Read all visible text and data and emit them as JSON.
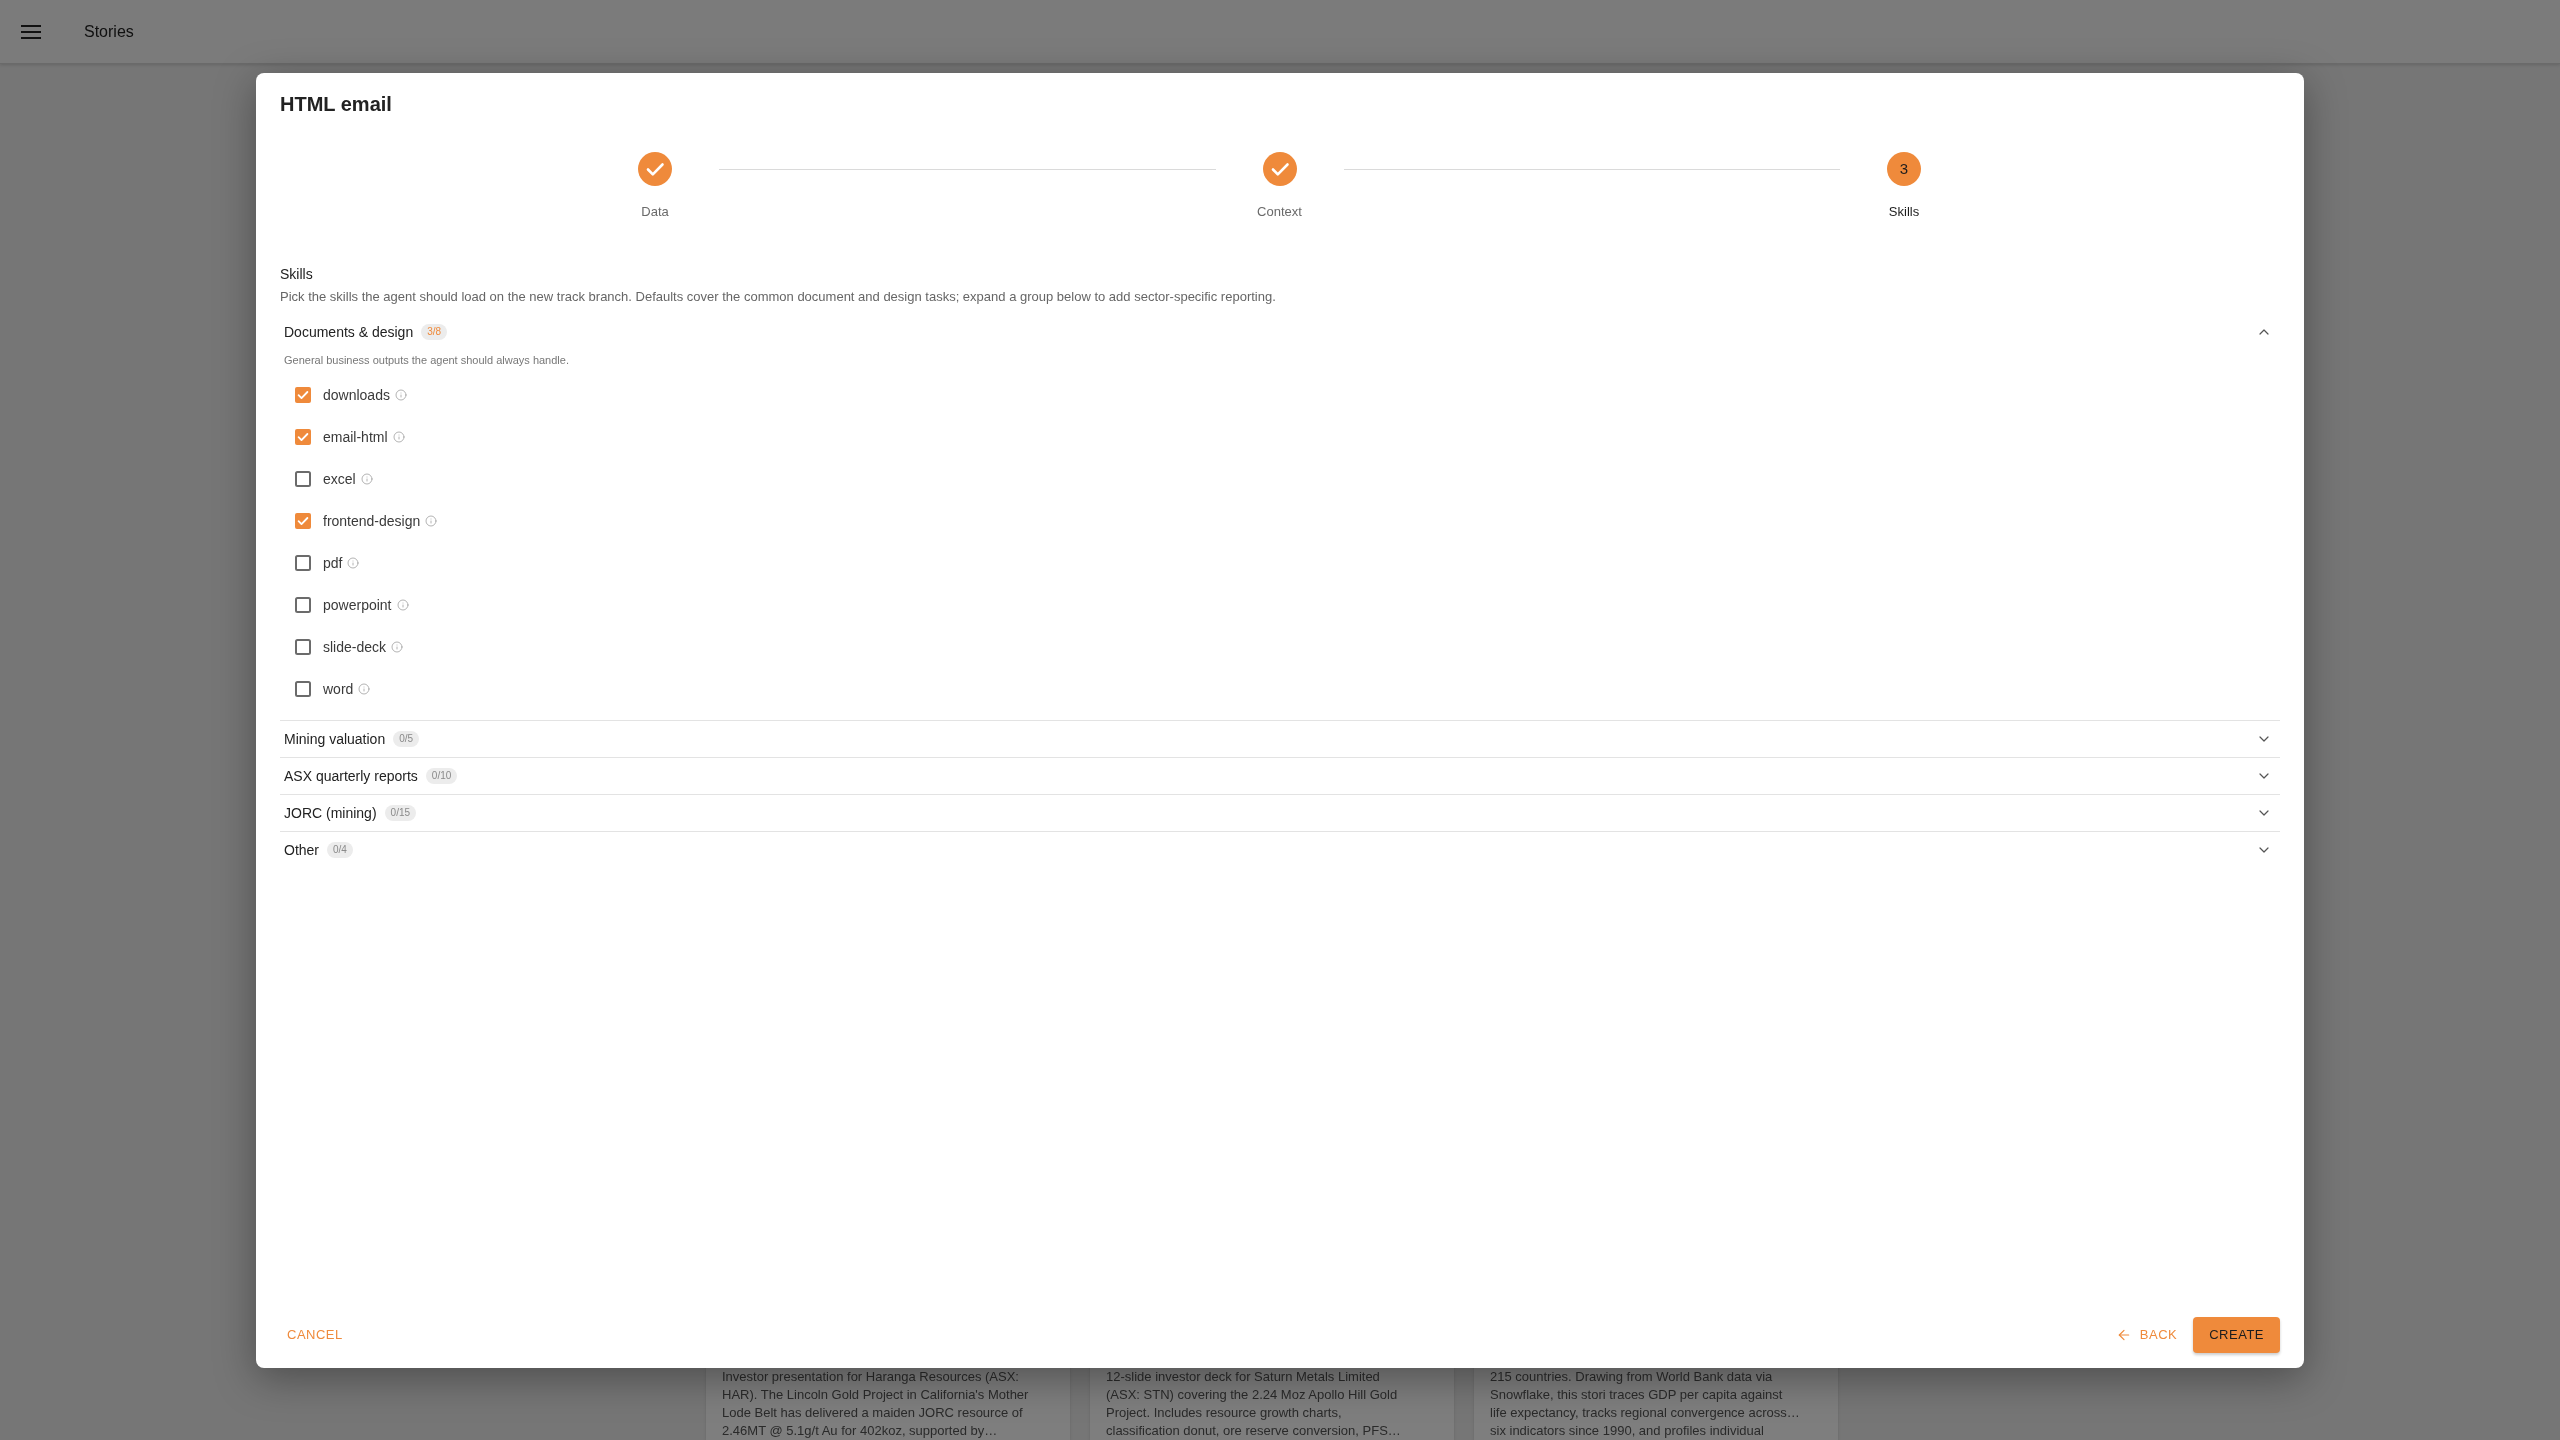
{
  "app_bar": {
    "title": "Stories"
  },
  "background_cards": [
    {
      "lines": [
        "Investor presentation for Haranga Resources (ASX:",
        "HAR). The Lincoln Gold Project in California's Mother",
        "Lode Belt has delivered a maiden JORC resource of",
        "2.46MT @ 5.1g/t Au for 402koz, supported by…"
      ]
    },
    {
      "lines": [
        "12-slide investor deck for Saturn Metals Limited",
        "(ASX: STN) covering the 2.24 Moz Apollo Hill Gold",
        "Project. Includes resource growth charts,",
        "classification donut, ore reserve conversion, PFS…"
      ]
    },
    {
      "lines": [
        "215 countries. Drawing from World Bank data via",
        "Snowflake, this stori traces GDP per capita against",
        "life expectancy, tracks regional convergence across…",
        "six indicators since 1990, and profiles individual"
      ]
    }
  ],
  "dialog": {
    "title": "HTML email",
    "steps": [
      {
        "label": "Data",
        "completed": true,
        "selected": false
      },
      {
        "label": "Context",
        "completed": true,
        "selected": false
      },
      {
        "label": "Skills",
        "number": "3",
        "completed": false,
        "selected": true
      }
    ],
    "section": {
      "title": "Skills",
      "description": "Pick the skills the agent should load on the new track branch. Defaults cover the common document and design tasks; expand a group below to add sector-specific reporting."
    },
    "groups": [
      {
        "title": "Documents & design",
        "count": "3/8",
        "count_active": true,
        "expanded": true,
        "description": "General business outputs the agent should always handle.",
        "skills": [
          {
            "name": "downloads",
            "checked": true
          },
          {
            "name": "email-html",
            "checked": true
          },
          {
            "name": "excel",
            "checked": false
          },
          {
            "name": "frontend-design",
            "checked": true
          },
          {
            "name": "pdf",
            "checked": false
          },
          {
            "name": "powerpoint",
            "checked": false
          },
          {
            "name": "slide-deck",
            "checked": false
          },
          {
            "name": "word",
            "checked": false
          }
        ]
      },
      {
        "title": "Mining valuation",
        "count": "0/5",
        "count_active": false,
        "expanded": false
      },
      {
        "title": "ASX quarterly reports",
        "count": "0/10",
        "count_active": false,
        "expanded": false
      },
      {
        "title": "JORC (mining)",
        "count": "0/15",
        "count_active": false,
        "expanded": false
      },
      {
        "title": "Other",
        "count": "0/4",
        "count_active": false,
        "expanded": false
      }
    ],
    "footer": {
      "cancel": "CANCEL",
      "back": "BACK",
      "create": "CREATE"
    }
  }
}
